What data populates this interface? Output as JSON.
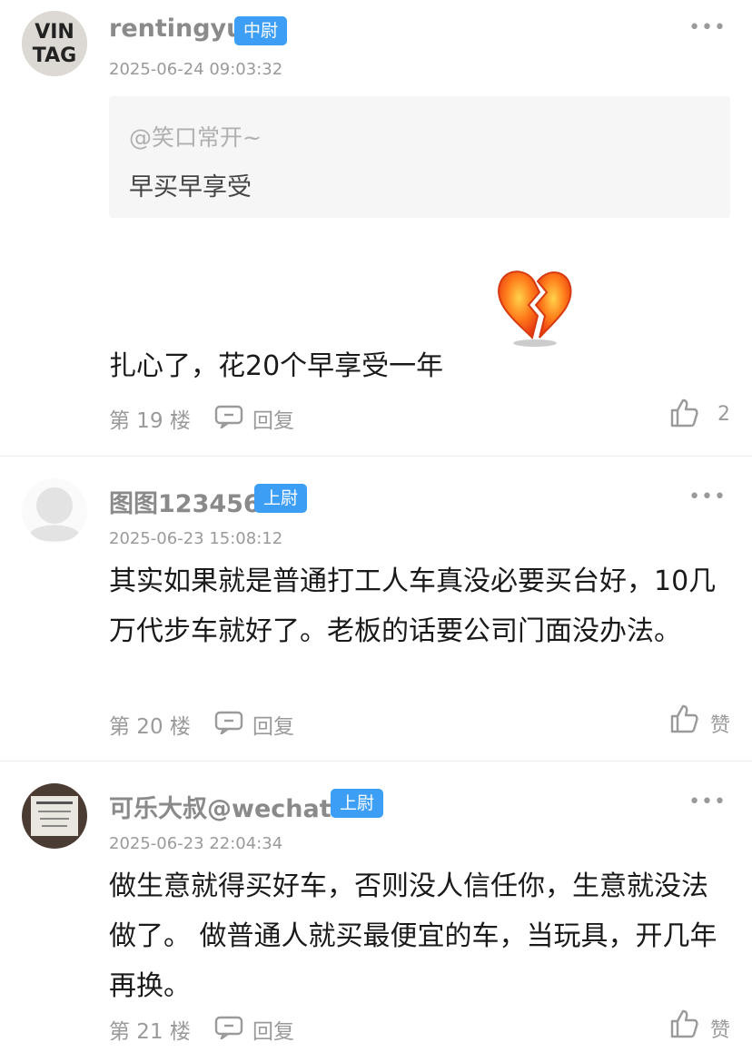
{
  "comments": [
    {
      "username": "rentingyu",
      "badge": "中尉",
      "time": "2025-06-24 09:03:32",
      "quote": {
        "user": "@笑口常开~",
        "text": "早买早享受"
      },
      "text": "扎心了，花20个早享受一年",
      "floor": "第 19 楼",
      "reply": "回复",
      "likes": "2",
      "avatar_text": [
        "VIN",
        "TAG"
      ]
    },
    {
      "username": "图图123456",
      "badge": "上尉",
      "time": "2025-06-23 15:08:12",
      "text": "其实如果就是普通打工人车真没必要买台好，10几万代步车就好了。老板的话要公司门面没办法。",
      "floor": "第 20 楼",
      "reply": "回复",
      "likes": "赞"
    },
    {
      "username": "可乐大叔@wechat",
      "badge": "上尉",
      "time": "2025-06-23 22:04:34",
      "text": "做生意就得买好车，否则没人信任你，生意就没法做了。 做普通人就买最便宜的车，当玩具，开几年再换。",
      "floor": "第 21 楼",
      "reply": "回复",
      "likes": "赞"
    }
  ],
  "colors": {
    "badge": "#3d9ef5",
    "muted": "#9a9a9a",
    "divider": "#ececec"
  }
}
